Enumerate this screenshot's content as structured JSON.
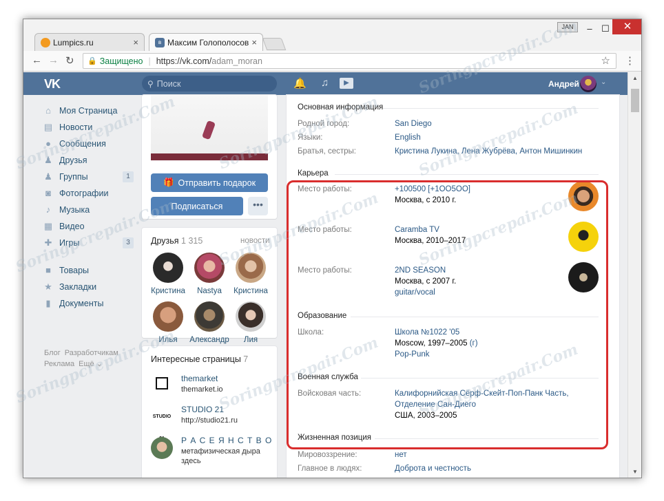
{
  "browser": {
    "tabs": [
      {
        "title": "Lumpics.ru",
        "close": "×"
      },
      {
        "title": "Максим Голополосов",
        "close": "×"
      }
    ],
    "window_badge": "JAN",
    "controls": {
      "minimize": "–",
      "maximize": "☐",
      "close": "✕"
    },
    "secure_label": "Защищено",
    "url_proto": "https://vk.com/",
    "url_path": "adam_moran"
  },
  "vk": {
    "logo": "VK",
    "search_placeholder": "Поиск",
    "user_name": "Андрей"
  },
  "left_menu": {
    "items": [
      {
        "label": "Моя Страница",
        "icon": "home-icon",
        "count": ""
      },
      {
        "label": "Новости",
        "icon": "news-icon",
        "count": ""
      },
      {
        "label": "Сообщения",
        "icon": "messages-icon",
        "count": ""
      },
      {
        "label": "Друзья",
        "icon": "friends-icon",
        "count": ""
      },
      {
        "label": "Группы",
        "icon": "groups-icon",
        "count": "1"
      },
      {
        "label": "Фотографии",
        "icon": "camera-icon",
        "count": ""
      },
      {
        "label": "Музыка",
        "icon": "music-icon",
        "count": ""
      },
      {
        "label": "Видео",
        "icon": "video-icon",
        "count": ""
      },
      {
        "label": "Игры",
        "icon": "gamepad-icon",
        "count": "3"
      },
      {
        "label": "Товары",
        "icon": "bag-icon",
        "count": ""
      },
      {
        "label": "Закладки",
        "icon": "star-icon",
        "count": ""
      },
      {
        "label": "Документы",
        "icon": "document-icon",
        "count": ""
      }
    ],
    "footer": [
      "Блог",
      "Разработчикам",
      "Реклама",
      "Ещё ⌄"
    ]
  },
  "profile": {
    "gift_button": "Отправить подарок",
    "subscribe_button": "Подписаться",
    "more_button": "•••",
    "friends": {
      "title": "Друзья",
      "count": "1 315",
      "link": "новости",
      "list": [
        "Кристина",
        "Nastya",
        "Кристина",
        "Илья",
        "Александр",
        "Лия"
      ]
    },
    "pages": {
      "title": "Интересные страницы",
      "count": "7",
      "list": [
        {
          "name": "themarket",
          "sub": "themarket.io"
        },
        {
          "name": "STUDIO 21",
          "sub": "http://studio21.ru",
          "logo_text": "STUDIO 21"
        },
        {
          "name": "Р А С Е Я Н С Т В О",
          "sub": "метафизическая дыра здесь"
        }
      ]
    }
  },
  "info": {
    "main": {
      "title": "Основная информация",
      "rows": [
        {
          "label": "Родной город:",
          "value": "San Diego"
        },
        {
          "label": "Языки:",
          "value": "English"
        },
        {
          "label": "Братья, сестры:",
          "value": "Кристина Лукина, Лена Жубрёва, Антон Мишинкин"
        }
      ]
    },
    "career": {
      "title": "Карьера",
      "jobs": [
        {
          "label": "Место работы:",
          "company": "+100500 [+1OO5OO]",
          "detail": "Москва, с 2010 г.",
          "role": ""
        },
        {
          "label": "Место работы:",
          "company": "Caramba TV",
          "detail": "Москва, 2010–2017",
          "role": ""
        },
        {
          "label": "Место работы:",
          "company": "2ND SEASON",
          "detail": "Москва, с 2007 г.",
          "role": "guitar/vocal"
        }
      ]
    },
    "education": {
      "title": "Образование",
      "label": "Школа:",
      "school": "Школа №1022 '05",
      "city_years": "Moscow, 1997–2005",
      "suffix": "(г)",
      "spec": "Pop-Punk"
    },
    "military": {
      "title": "Военная служба",
      "label": "Войсковая часть:",
      "unit": "Калифорнийская Сёрф-Скейт-Поп-Панк Часть,",
      "unit2": "Отделение Сан-Диего",
      "years": "США, 2003–2005"
    },
    "life": {
      "title": "Жизненная позиция",
      "rows": [
        {
          "label": "Мировоззрение:",
          "value": "нет"
        },
        {
          "label": "Главное в людях:",
          "value": "Доброта и честность"
        }
      ]
    }
  },
  "watermark": "Soringpcrepair.Com",
  "colors": {
    "vk_blue": "#507299",
    "link": "#2a5885",
    "highlight": "#d92d2d"
  }
}
